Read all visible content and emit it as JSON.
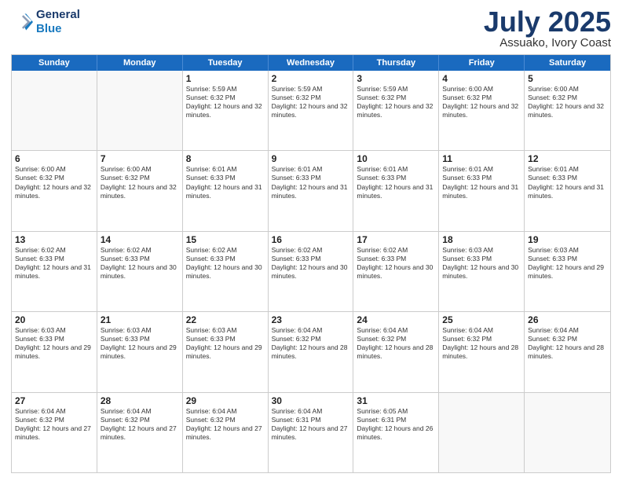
{
  "header": {
    "logo_line1": "General",
    "logo_line2": "Blue",
    "month_title": "July 2025",
    "location": "Assuako, Ivory Coast"
  },
  "weekdays": [
    "Sunday",
    "Monday",
    "Tuesday",
    "Wednesday",
    "Thursday",
    "Friday",
    "Saturday"
  ],
  "weeks": [
    [
      {
        "day": "",
        "text": ""
      },
      {
        "day": "",
        "text": ""
      },
      {
        "day": "1",
        "text": "Sunrise: 5:59 AM\nSunset: 6:32 PM\nDaylight: 12 hours and 32 minutes."
      },
      {
        "day": "2",
        "text": "Sunrise: 5:59 AM\nSunset: 6:32 PM\nDaylight: 12 hours and 32 minutes."
      },
      {
        "day": "3",
        "text": "Sunrise: 5:59 AM\nSunset: 6:32 PM\nDaylight: 12 hours and 32 minutes."
      },
      {
        "day": "4",
        "text": "Sunrise: 6:00 AM\nSunset: 6:32 PM\nDaylight: 12 hours and 32 minutes."
      },
      {
        "day": "5",
        "text": "Sunrise: 6:00 AM\nSunset: 6:32 PM\nDaylight: 12 hours and 32 minutes."
      }
    ],
    [
      {
        "day": "6",
        "text": "Sunrise: 6:00 AM\nSunset: 6:32 PM\nDaylight: 12 hours and 32 minutes."
      },
      {
        "day": "7",
        "text": "Sunrise: 6:00 AM\nSunset: 6:32 PM\nDaylight: 12 hours and 32 minutes."
      },
      {
        "day": "8",
        "text": "Sunrise: 6:01 AM\nSunset: 6:33 PM\nDaylight: 12 hours and 31 minutes."
      },
      {
        "day": "9",
        "text": "Sunrise: 6:01 AM\nSunset: 6:33 PM\nDaylight: 12 hours and 31 minutes."
      },
      {
        "day": "10",
        "text": "Sunrise: 6:01 AM\nSunset: 6:33 PM\nDaylight: 12 hours and 31 minutes."
      },
      {
        "day": "11",
        "text": "Sunrise: 6:01 AM\nSunset: 6:33 PM\nDaylight: 12 hours and 31 minutes."
      },
      {
        "day": "12",
        "text": "Sunrise: 6:01 AM\nSunset: 6:33 PM\nDaylight: 12 hours and 31 minutes."
      }
    ],
    [
      {
        "day": "13",
        "text": "Sunrise: 6:02 AM\nSunset: 6:33 PM\nDaylight: 12 hours and 31 minutes."
      },
      {
        "day": "14",
        "text": "Sunrise: 6:02 AM\nSunset: 6:33 PM\nDaylight: 12 hours and 30 minutes."
      },
      {
        "day": "15",
        "text": "Sunrise: 6:02 AM\nSunset: 6:33 PM\nDaylight: 12 hours and 30 minutes."
      },
      {
        "day": "16",
        "text": "Sunrise: 6:02 AM\nSunset: 6:33 PM\nDaylight: 12 hours and 30 minutes."
      },
      {
        "day": "17",
        "text": "Sunrise: 6:02 AM\nSunset: 6:33 PM\nDaylight: 12 hours and 30 minutes."
      },
      {
        "day": "18",
        "text": "Sunrise: 6:03 AM\nSunset: 6:33 PM\nDaylight: 12 hours and 30 minutes."
      },
      {
        "day": "19",
        "text": "Sunrise: 6:03 AM\nSunset: 6:33 PM\nDaylight: 12 hours and 29 minutes."
      }
    ],
    [
      {
        "day": "20",
        "text": "Sunrise: 6:03 AM\nSunset: 6:33 PM\nDaylight: 12 hours and 29 minutes."
      },
      {
        "day": "21",
        "text": "Sunrise: 6:03 AM\nSunset: 6:33 PM\nDaylight: 12 hours and 29 minutes."
      },
      {
        "day": "22",
        "text": "Sunrise: 6:03 AM\nSunset: 6:33 PM\nDaylight: 12 hours and 29 minutes."
      },
      {
        "day": "23",
        "text": "Sunrise: 6:04 AM\nSunset: 6:32 PM\nDaylight: 12 hours and 28 minutes."
      },
      {
        "day": "24",
        "text": "Sunrise: 6:04 AM\nSunset: 6:32 PM\nDaylight: 12 hours and 28 minutes."
      },
      {
        "day": "25",
        "text": "Sunrise: 6:04 AM\nSunset: 6:32 PM\nDaylight: 12 hours and 28 minutes."
      },
      {
        "day": "26",
        "text": "Sunrise: 6:04 AM\nSunset: 6:32 PM\nDaylight: 12 hours and 28 minutes."
      }
    ],
    [
      {
        "day": "27",
        "text": "Sunrise: 6:04 AM\nSunset: 6:32 PM\nDaylight: 12 hours and 27 minutes."
      },
      {
        "day": "28",
        "text": "Sunrise: 6:04 AM\nSunset: 6:32 PM\nDaylight: 12 hours and 27 minutes."
      },
      {
        "day": "29",
        "text": "Sunrise: 6:04 AM\nSunset: 6:32 PM\nDaylight: 12 hours and 27 minutes."
      },
      {
        "day": "30",
        "text": "Sunrise: 6:04 AM\nSunset: 6:31 PM\nDaylight: 12 hours and 27 minutes."
      },
      {
        "day": "31",
        "text": "Sunrise: 6:05 AM\nSunset: 6:31 PM\nDaylight: 12 hours and 26 minutes."
      },
      {
        "day": "",
        "text": ""
      },
      {
        "day": "",
        "text": ""
      }
    ]
  ]
}
